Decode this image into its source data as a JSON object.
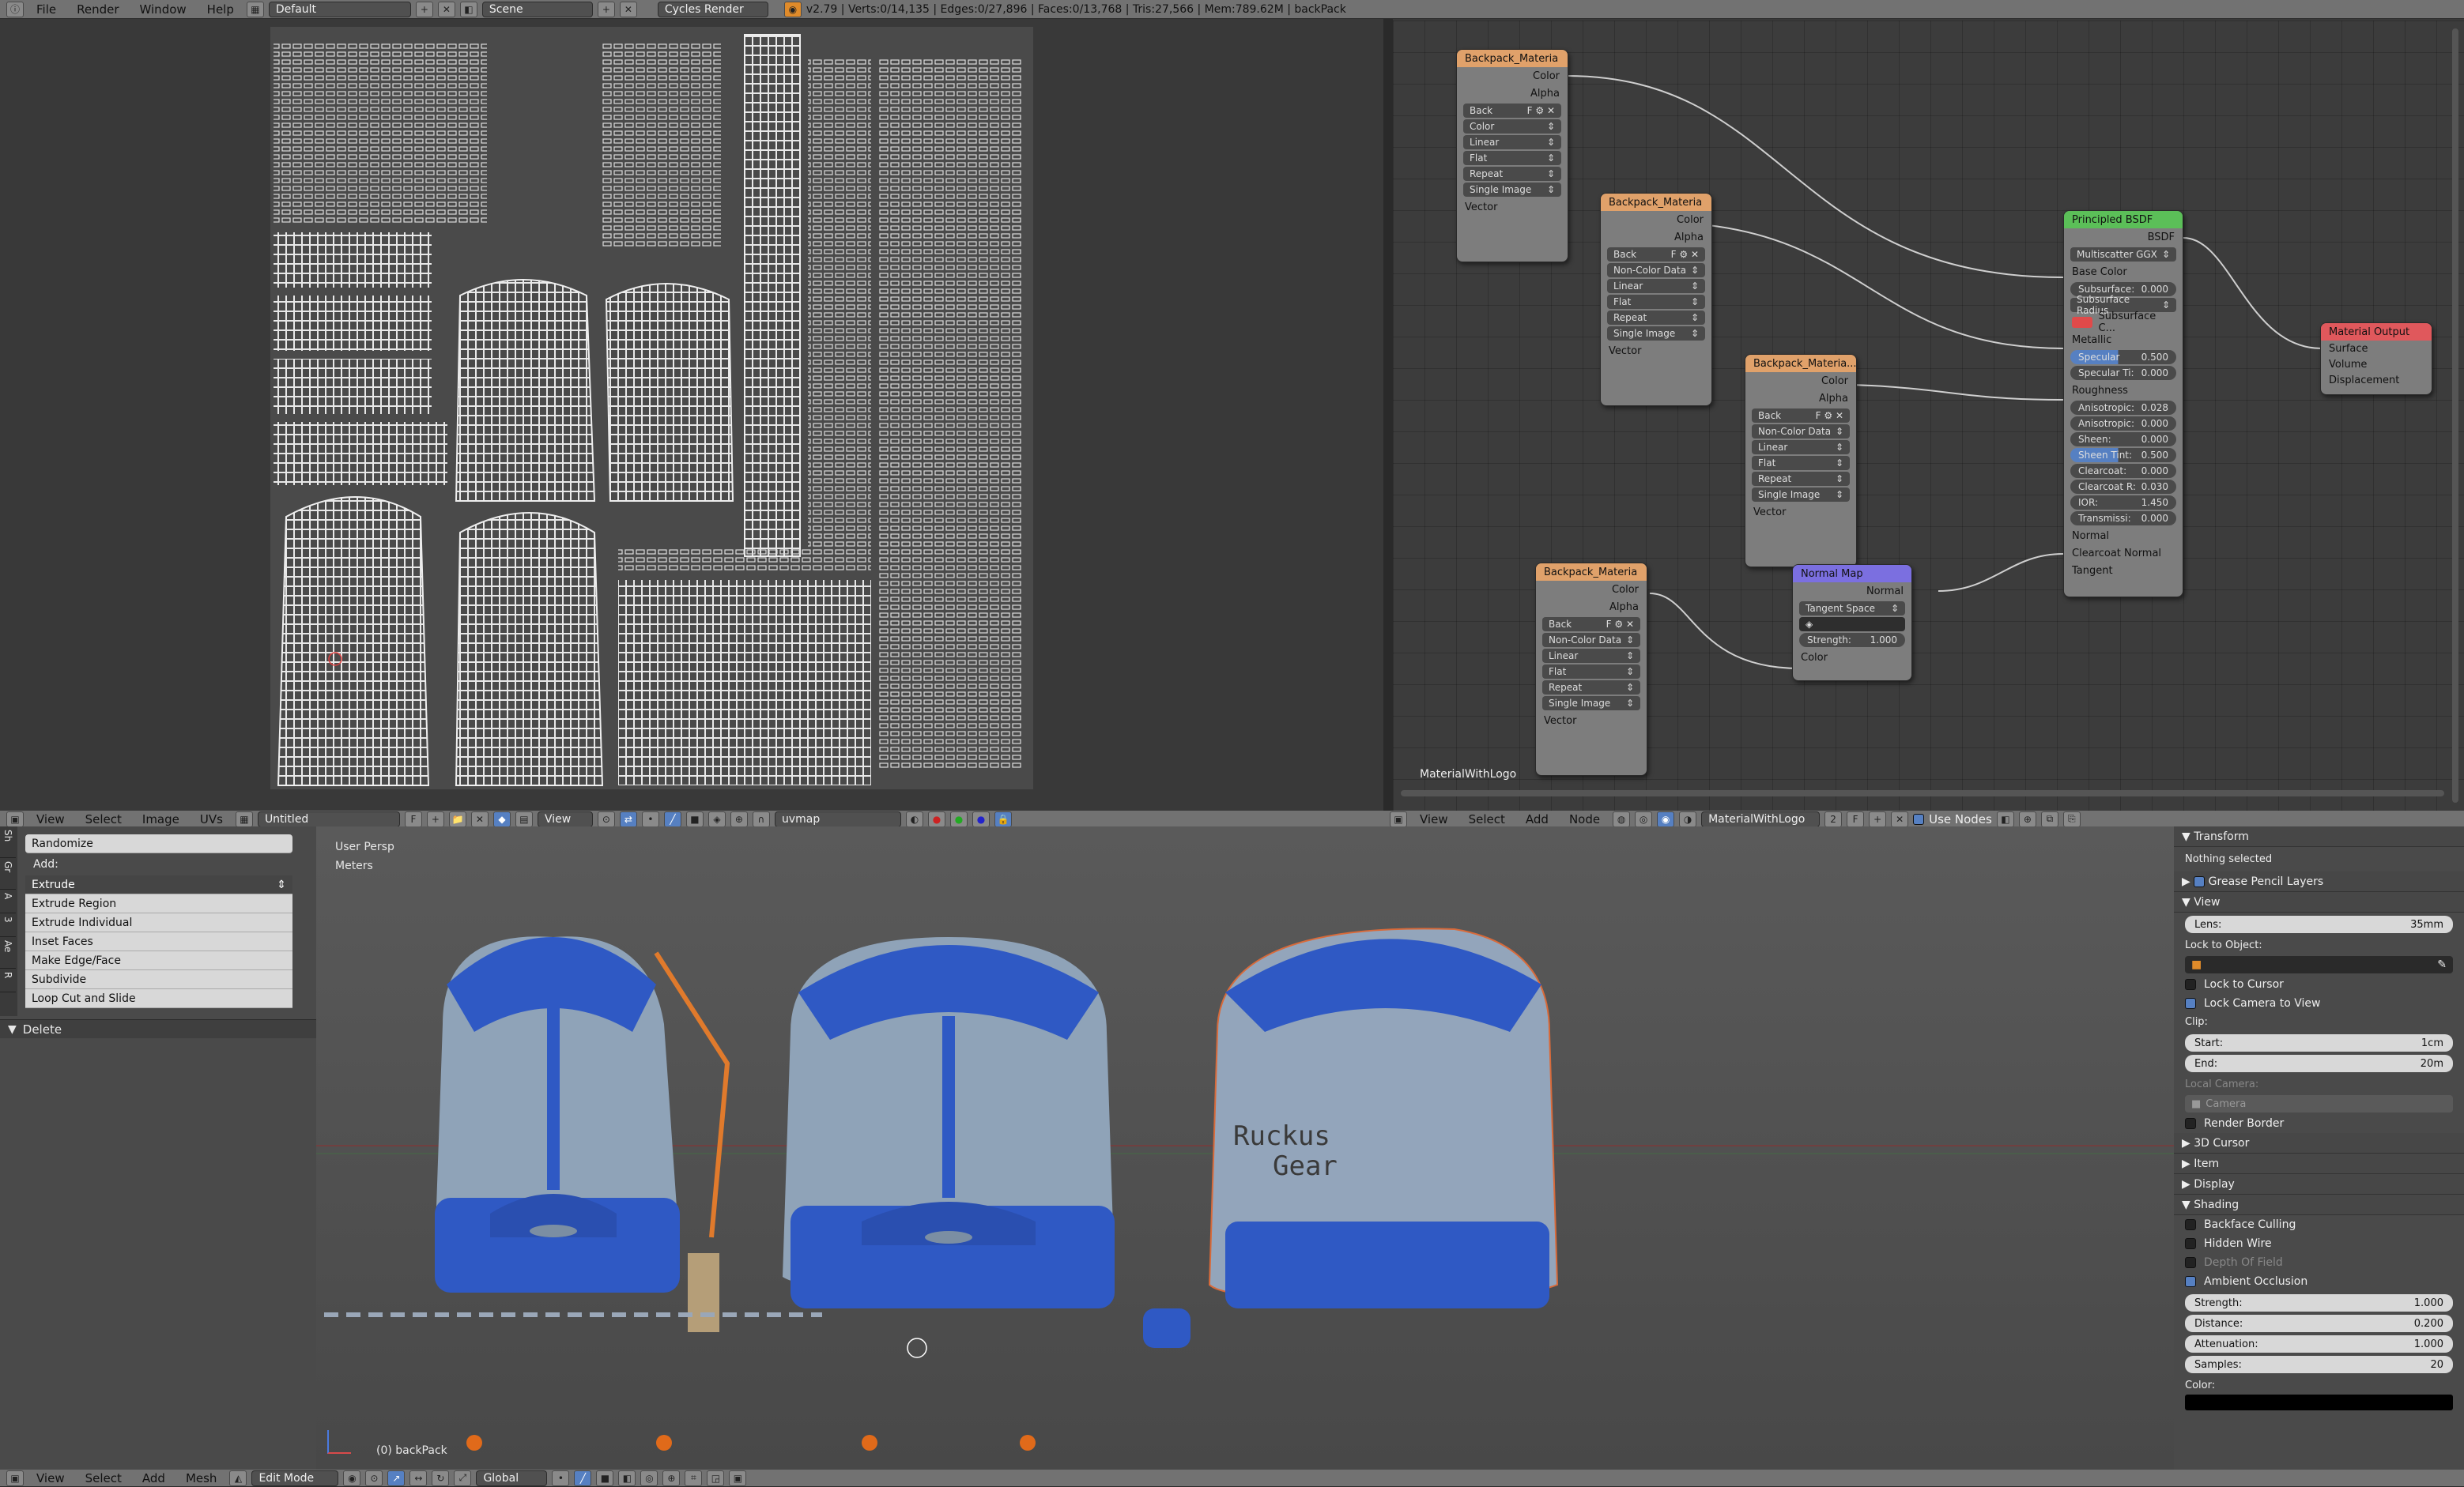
{
  "topbar": {
    "menu": [
      "File",
      "Render",
      "Window",
      "Help"
    ],
    "layout": "Default",
    "scene": "Scene",
    "engine": "Cycles Render",
    "stats": "v2.79 | Verts:0/14,135 | Edges:0/27,896 | Faces:0/13,768 | Tris:27,566 | Mem:789.62M | backPack"
  },
  "node_editor": {
    "material_label": "MaterialWithLogo",
    "nodes": {
      "tex1": {
        "title": "Backpack_Materia",
        "out_color": "Color",
        "out_alpha": "Alpha",
        "img": "Back",
        "colorspace": "Color",
        "interp": "Linear",
        "proj": "Flat",
        "ext": "Repeat",
        "source": "Single Image",
        "in_vector": "Vector"
      },
      "tex2": {
        "title": "Backpack_Materia",
        "out_color": "Color",
        "out_alpha": "Alpha",
        "img": "Back",
        "colorspace": "Non-Color Data",
        "interp": "Linear",
        "proj": "Flat",
        "ext": "Repeat",
        "source": "Single Image",
        "in_vector": "Vector"
      },
      "tex3": {
        "title": "Backpack_Materia...",
        "out_color": "Color",
        "out_alpha": "Alpha",
        "img": "Back",
        "colorspace": "Non-Color Data",
        "interp": "Linear",
        "proj": "Flat",
        "ext": "Repeat",
        "source": "Single Image",
        "in_vector": "Vector"
      },
      "tex4": {
        "title": "Backpack_Materia",
        "out_color": "Color",
        "out_alpha": "Alpha",
        "img": "Back",
        "colorspace": "Non-Color Data",
        "interp": "Linear",
        "proj": "Flat",
        "ext": "Repeat",
        "source": "Single Image",
        "in_vector": "Vector"
      },
      "normal": {
        "title": "Normal Map",
        "out": "Normal",
        "space": "Tangent Space",
        "strength_label": "Strength:",
        "strength": "1.000",
        "in_color": "Color"
      },
      "bsdf": {
        "title": "Principled BSDF",
        "out": "BSDF",
        "dist": "Multiscatter GGX",
        "base_color": "Base Color",
        "fields": [
          [
            "Subsurface:",
            "0.000"
          ],
          [
            "Subsurface Radius",
            ""
          ]
        ],
        "sub_color": "Subsurface C...",
        "metallic": "Metallic",
        "specular_label": "Specular",
        "specular": "0.500",
        "rows2": [
          [
            "Specular Ti:",
            "0.000"
          ]
        ],
        "roughness": "Roughness",
        "rows3": [
          [
            "Anisotropic:",
            "0.028"
          ],
          [
            "Anisotropic:",
            "0.000"
          ],
          [
            "Sheen:",
            "0.000"
          ],
          [
            "Sheen Tint:",
            "0.500"
          ],
          [
            "Clearcoat:",
            "0.000"
          ],
          [
            "Clearcoat R:",
            "0.030"
          ],
          [
            "IOR:",
            "1.450"
          ],
          [
            "Transmissi:",
            "0.000"
          ]
        ],
        "normal": "Normal",
        "clearcoat_normal": "Clearcoat Normal",
        "tangent": "Tangent"
      },
      "output": {
        "title": "Material Output",
        "surface": "Surface",
        "volume": "Volume",
        "displacement": "Displacement"
      }
    }
  },
  "uv_header": {
    "menu": [
      "View",
      "Select",
      "Image",
      "UVs"
    ],
    "image_name": "Untitled",
    "view": "View",
    "uvmap": "uvmap"
  },
  "node_header": {
    "menu": [
      "View",
      "Select",
      "Add",
      "Node"
    ],
    "material": "MaterialWithLogo",
    "users": "2",
    "use_nodes": "Use Nodes"
  },
  "tool_panel": {
    "tabs": [
      "Sh",
      "Gr",
      "A",
      "3",
      "Ae",
      "R"
    ],
    "randomize": "Randomize",
    "add_label": "Add:",
    "items": [
      "Extrude",
      "Extrude Region",
      "Extrude Individual",
      "Inset Faces",
      "Make Edge/Face",
      "Subdivide",
      "Loop Cut and Slide"
    ],
    "delete_label": "Delete"
  },
  "viewport": {
    "persp": "User Persp",
    "units": "Meters",
    "object": "(0) backPack",
    "logo_line1": "Ruckus",
    "logo_line2": "Gear"
  },
  "view_header": {
    "menu": [
      "View",
      "Select",
      "Add",
      "Mesh"
    ],
    "mode": "Edit Mode",
    "orientation": "Global"
  },
  "properties": {
    "transform": "Transform",
    "nothing": "Nothing selected",
    "grease": "Grease Pencil Layers",
    "view": "View",
    "lens_label": "Lens:",
    "lens": "35mm",
    "lock_obj": "Lock to Object:",
    "lock_cursor": "Lock to Cursor",
    "lock_cam": "Lock Camera to View",
    "clip": "Clip:",
    "start_label": "Start:",
    "start": "1cm",
    "end_label": "End:",
    "end": "20m",
    "local_cam": "Local Camera:",
    "camera": "Camera",
    "render_border": "Render Border",
    "cursor": "3D Cursor",
    "item": "Item",
    "display": "Display",
    "shading": "Shading",
    "backface": "Backface Culling",
    "hidden_wire": "Hidden Wire",
    "dof": "Depth Of Field",
    "ao": "Ambient Occlusion",
    "ao_fields": [
      [
        "Strength:",
        "1.000"
      ],
      [
        "Distance:",
        "0.200"
      ],
      [
        "Attenuation:",
        "1.000"
      ],
      [
        "Samples:",
        "20"
      ]
    ],
    "color_label": "Color:"
  },
  "colors": {
    "accent": "#5680c2",
    "tex_header": "#e0a16a",
    "shader_header": "#5bbf58",
    "output_header": "#e0585c",
    "vector_header": "#7b6fe0",
    "backpack_blue": "#2f59c4"
  }
}
